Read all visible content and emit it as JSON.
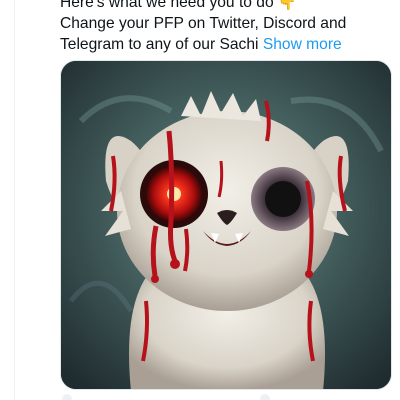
{
  "tweet": {
    "line1": "Here's what we need you to do",
    "line1_emoji": "👇",
    "line2": "Change your PFP on Twitter, Discord and",
    "line3": "Telegram to any of our Sachi",
    "show_more": "Show more"
  },
  "media": {
    "icon": "creepy-furry-creature-illustration"
  },
  "colors": {
    "link": "#1d9bf0",
    "text": "#0f1419",
    "eye_glow": "#ff2a1a",
    "blood": "#b5121b"
  }
}
